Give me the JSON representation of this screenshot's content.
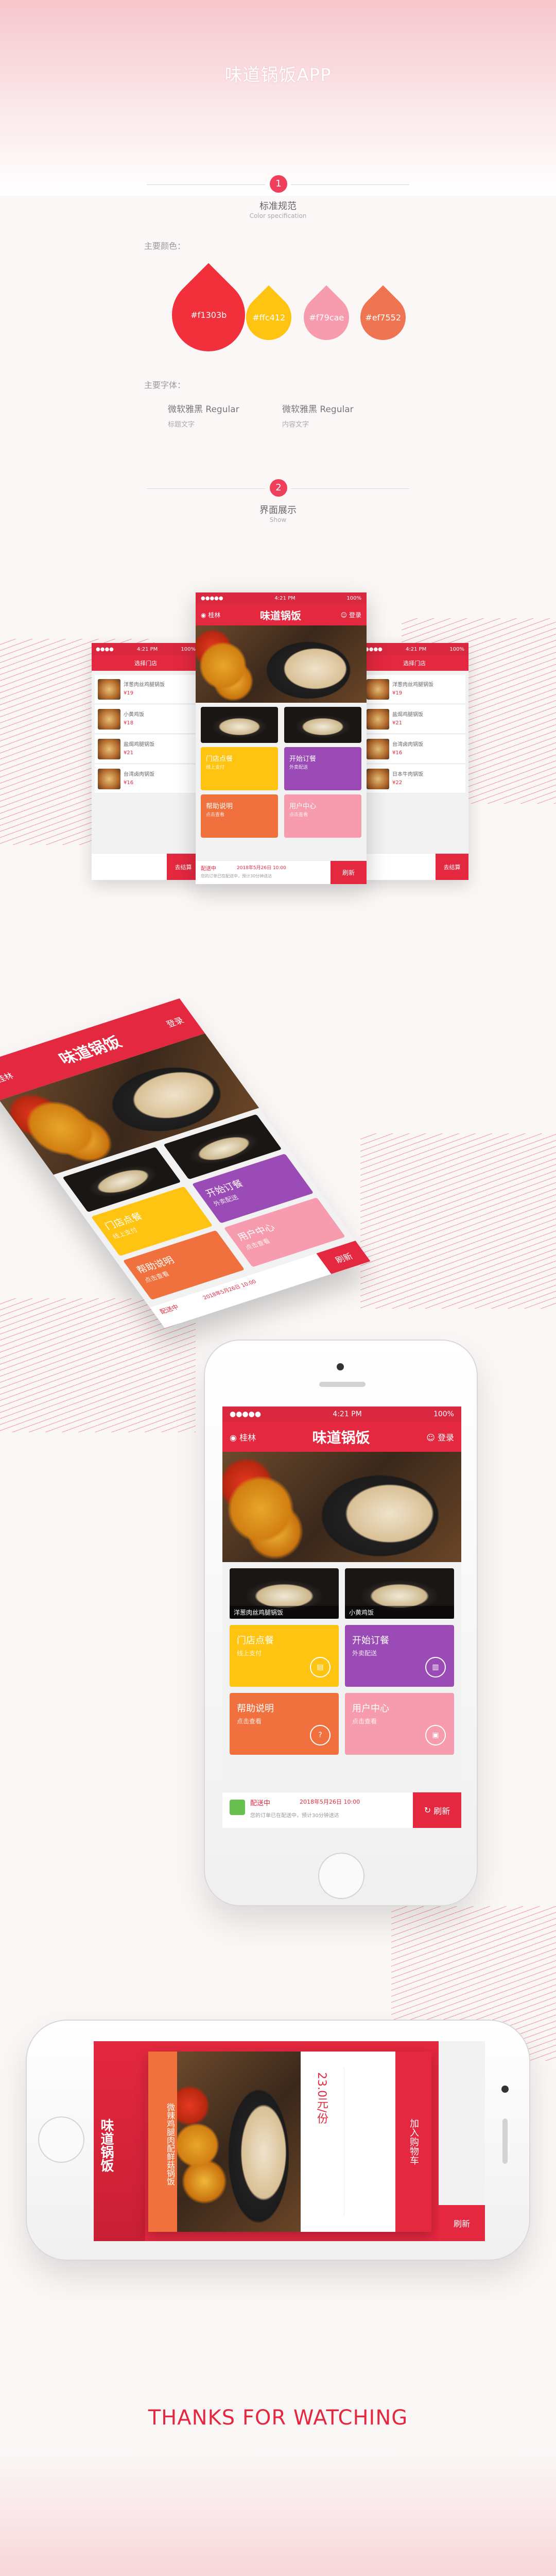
{
  "header": {
    "title": "味道锅饭APP"
  },
  "section1": {
    "number": "1",
    "title_cn": "标准规范",
    "title_en": "Color specification"
  },
  "colors_label": "主要颜色：",
  "colors": [
    {
      "hex": "#f1303b",
      "label": "#f1303b"
    },
    {
      "hex": "#ffc412",
      "label": "#ffc412"
    },
    {
      "hex": "#f79cae",
      "label": "#f79cae"
    },
    {
      "hex": "#ef7552",
      "label": "#ef7552"
    }
  ],
  "fonts_label": "主要字体：",
  "fonts": [
    {
      "name": "微软雅黑 Regular",
      "use": "标题文字"
    },
    {
      "name": "微软雅黑 Regular",
      "use": "内容文字"
    }
  ],
  "section2": {
    "number": "2",
    "title_cn": "界面展示",
    "title_en": "Show"
  },
  "app": {
    "time": "4:21 PM",
    "battery": "100%",
    "location": "桂林",
    "logo": "味道锅饭",
    "login": "登录",
    "dishes": [
      "洋葱肉丝鸡腿锅饭",
      "小黄鸡饭"
    ],
    "tiles": [
      {
        "title": "门店点餐",
        "sub": "线上支付"
      },
      {
        "title": "开始订餐",
        "sub": "外卖配送"
      },
      {
        "title": "帮助说明",
        "sub": "点击查看"
      },
      {
        "title": "用户中心",
        "sub": "点击查看"
      }
    ],
    "notice_title": "配送中",
    "notice_date": "2018年5月26日 10:00",
    "notice_text": "您的订单已在配送中，预计30分钟送达",
    "refresh": "刷新"
  },
  "side_screen": {
    "title": "选择门店",
    "items": [
      {
        "name": "洋葱肉丝鸡腿锅饭",
        "price": "¥19"
      },
      {
        "name": "小黄鸡饭",
        "price": "¥18"
      },
      {
        "name": "盐焗鸡腿锅饭",
        "price": "¥21"
      },
      {
        "name": "台湾卤肉锅饭",
        "price": "¥16"
      },
      {
        "name": "日本牛肉锅饭",
        "price": "¥22"
      }
    ],
    "checkout": "去结算"
  },
  "landscape": {
    "dish": "微辣鸡腿肉配鲜菇锅饭",
    "price": "23.0元/份",
    "add_to_cart": "加入购物车"
  },
  "footer": {
    "thanks": "THANKS FOR WATCHING"
  }
}
